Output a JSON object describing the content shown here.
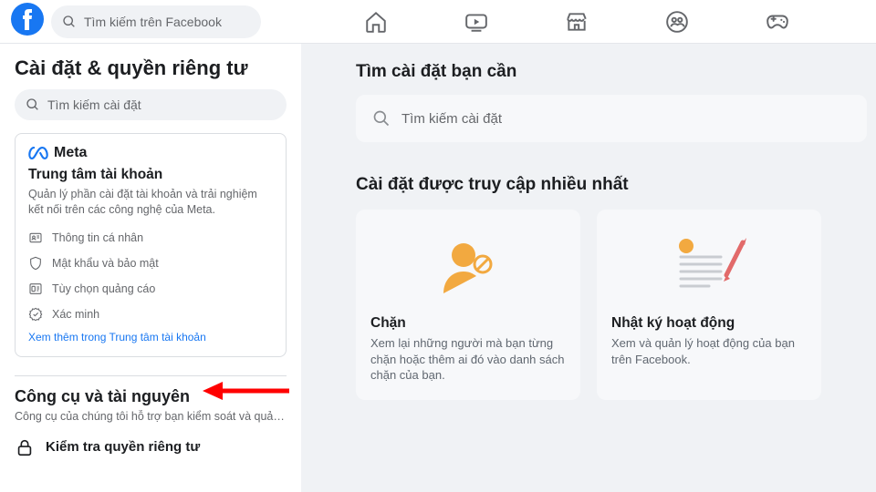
{
  "topbar": {
    "search_placeholder": "Tìm kiếm trên Facebook"
  },
  "sidebar": {
    "title": "Cài đặt & quyền riêng tư",
    "search_placeholder": "Tìm kiếm cài đặt",
    "meta_card": {
      "brand": "Meta",
      "heading": "Trung tâm tài khoản",
      "desc": "Quản lý phần cài đặt tài khoản và trải nghiệm kết nối trên các công nghệ của Meta.",
      "items": {
        "personal": "Thông tin cá nhân",
        "password": "Mật khẩu và bảo mật",
        "ads": "Tùy chọn quảng cáo",
        "verify": "Xác minh"
      },
      "more": "Xem thêm trong Trung tâm tài khoản"
    },
    "tools_heading": "Công cụ và tài nguyên",
    "tools_sub": "Công cụ của chúng tôi hỗ trợ bạn kiểm soát và quản l...",
    "privacy_check": "Kiểm tra quyền riêng tư"
  },
  "content": {
    "find_heading": "Tìm cài đặt bạn cần",
    "search_placeholder": "Tìm kiếm cài đặt",
    "most_heading": "Cài đặt được truy cập nhiều nhất",
    "tiles": {
      "block": {
        "title": "Chặn",
        "desc": "Xem lại những người mà bạn từng chặn hoặc thêm ai đó vào danh sách chặn của bạn."
      },
      "activity": {
        "title": "Nhật ký hoạt động",
        "desc": "Xem và quản lý hoạt động của bạn trên Facebook."
      }
    }
  }
}
